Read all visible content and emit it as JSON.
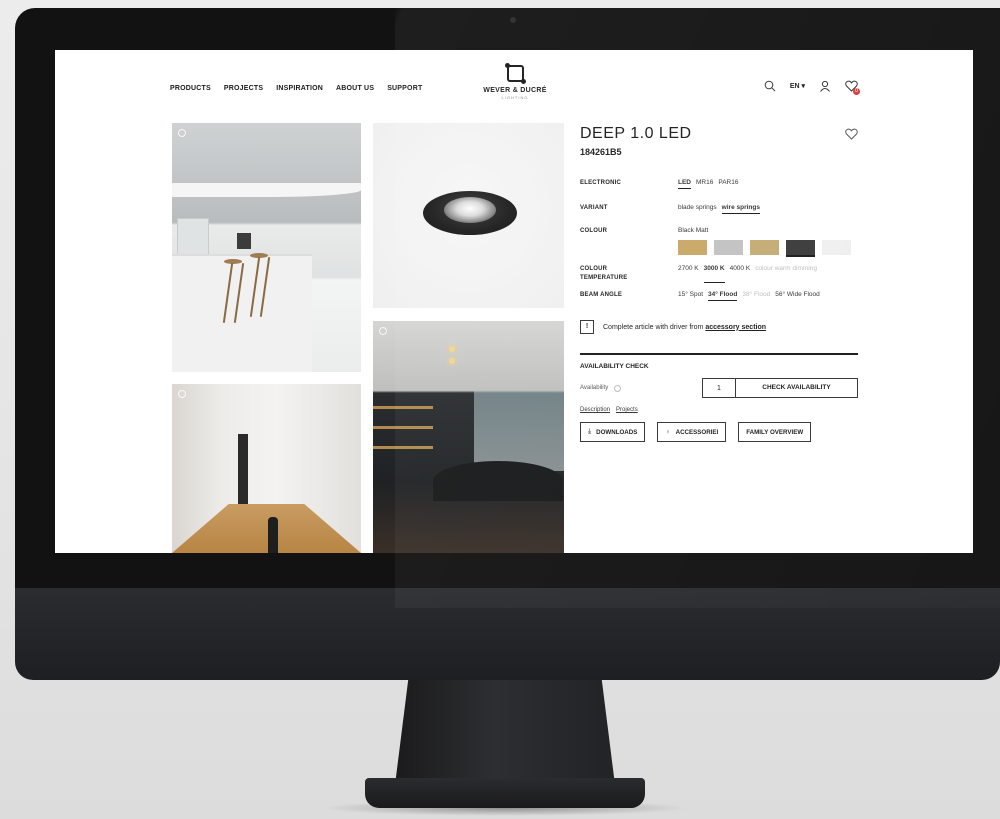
{
  "nav": {
    "items": [
      "PRODUCTS",
      "PROJECTS",
      "INSPIRATION",
      "ABOUT US",
      "SUPPORT"
    ]
  },
  "logo": {
    "name": "WEVER & DUCRÉ",
    "sub": "LIGHTING"
  },
  "utility": {
    "language": "EN ▾",
    "wishlist_count": "0"
  },
  "product": {
    "title": "DEEP 1.0 LED",
    "code": "184261B5",
    "options": {
      "electronic": {
        "label": "ELECTRONIC",
        "values": [
          "LED",
          "MR16",
          "PAR16"
        ],
        "selected": "LED"
      },
      "variant": {
        "label": "VARIANT",
        "values": [
          "blade springs",
          "wire springs"
        ],
        "selected": "wire springs"
      },
      "colour": {
        "label": "COLOUR",
        "selected_name": "Black Matt",
        "swatches": [
          "#c9a867",
          "#c2c2c2",
          "#c4ab74",
          "#3a3a3a",
          "#efefef"
        ],
        "selected_index": 3
      },
      "colour_temperature": {
        "label1": "COLOUR",
        "label2": "TEMPERATURE",
        "values": [
          "2700 K",
          "3000 K",
          "4000 K",
          "colour warm dimming"
        ],
        "selected": "3000 K",
        "disabled": [
          "colour warm dimming"
        ]
      },
      "beam_angle": {
        "label": "BEAM ANGLE",
        "values": [
          "15° Spot",
          "34° Flood",
          "38° Flood",
          "56° Wide Flood"
        ],
        "selected": "34° Flood",
        "disabled": [
          "38° Flood"
        ]
      }
    },
    "notice": {
      "icon": "!",
      "text": "Complete article with driver from",
      "link": "accessory section"
    },
    "availability": {
      "title": "AVAILABILITY CHECK",
      "label": "Availability",
      "quantity": "1",
      "button": "CHECK AVAILABILITY"
    },
    "tabs": [
      "Description",
      "Projects"
    ],
    "actions": {
      "downloads": "DOWNLOADS",
      "accessories": "ACCESSORIEI",
      "family": "FAMILY OVERVIEW"
    }
  }
}
